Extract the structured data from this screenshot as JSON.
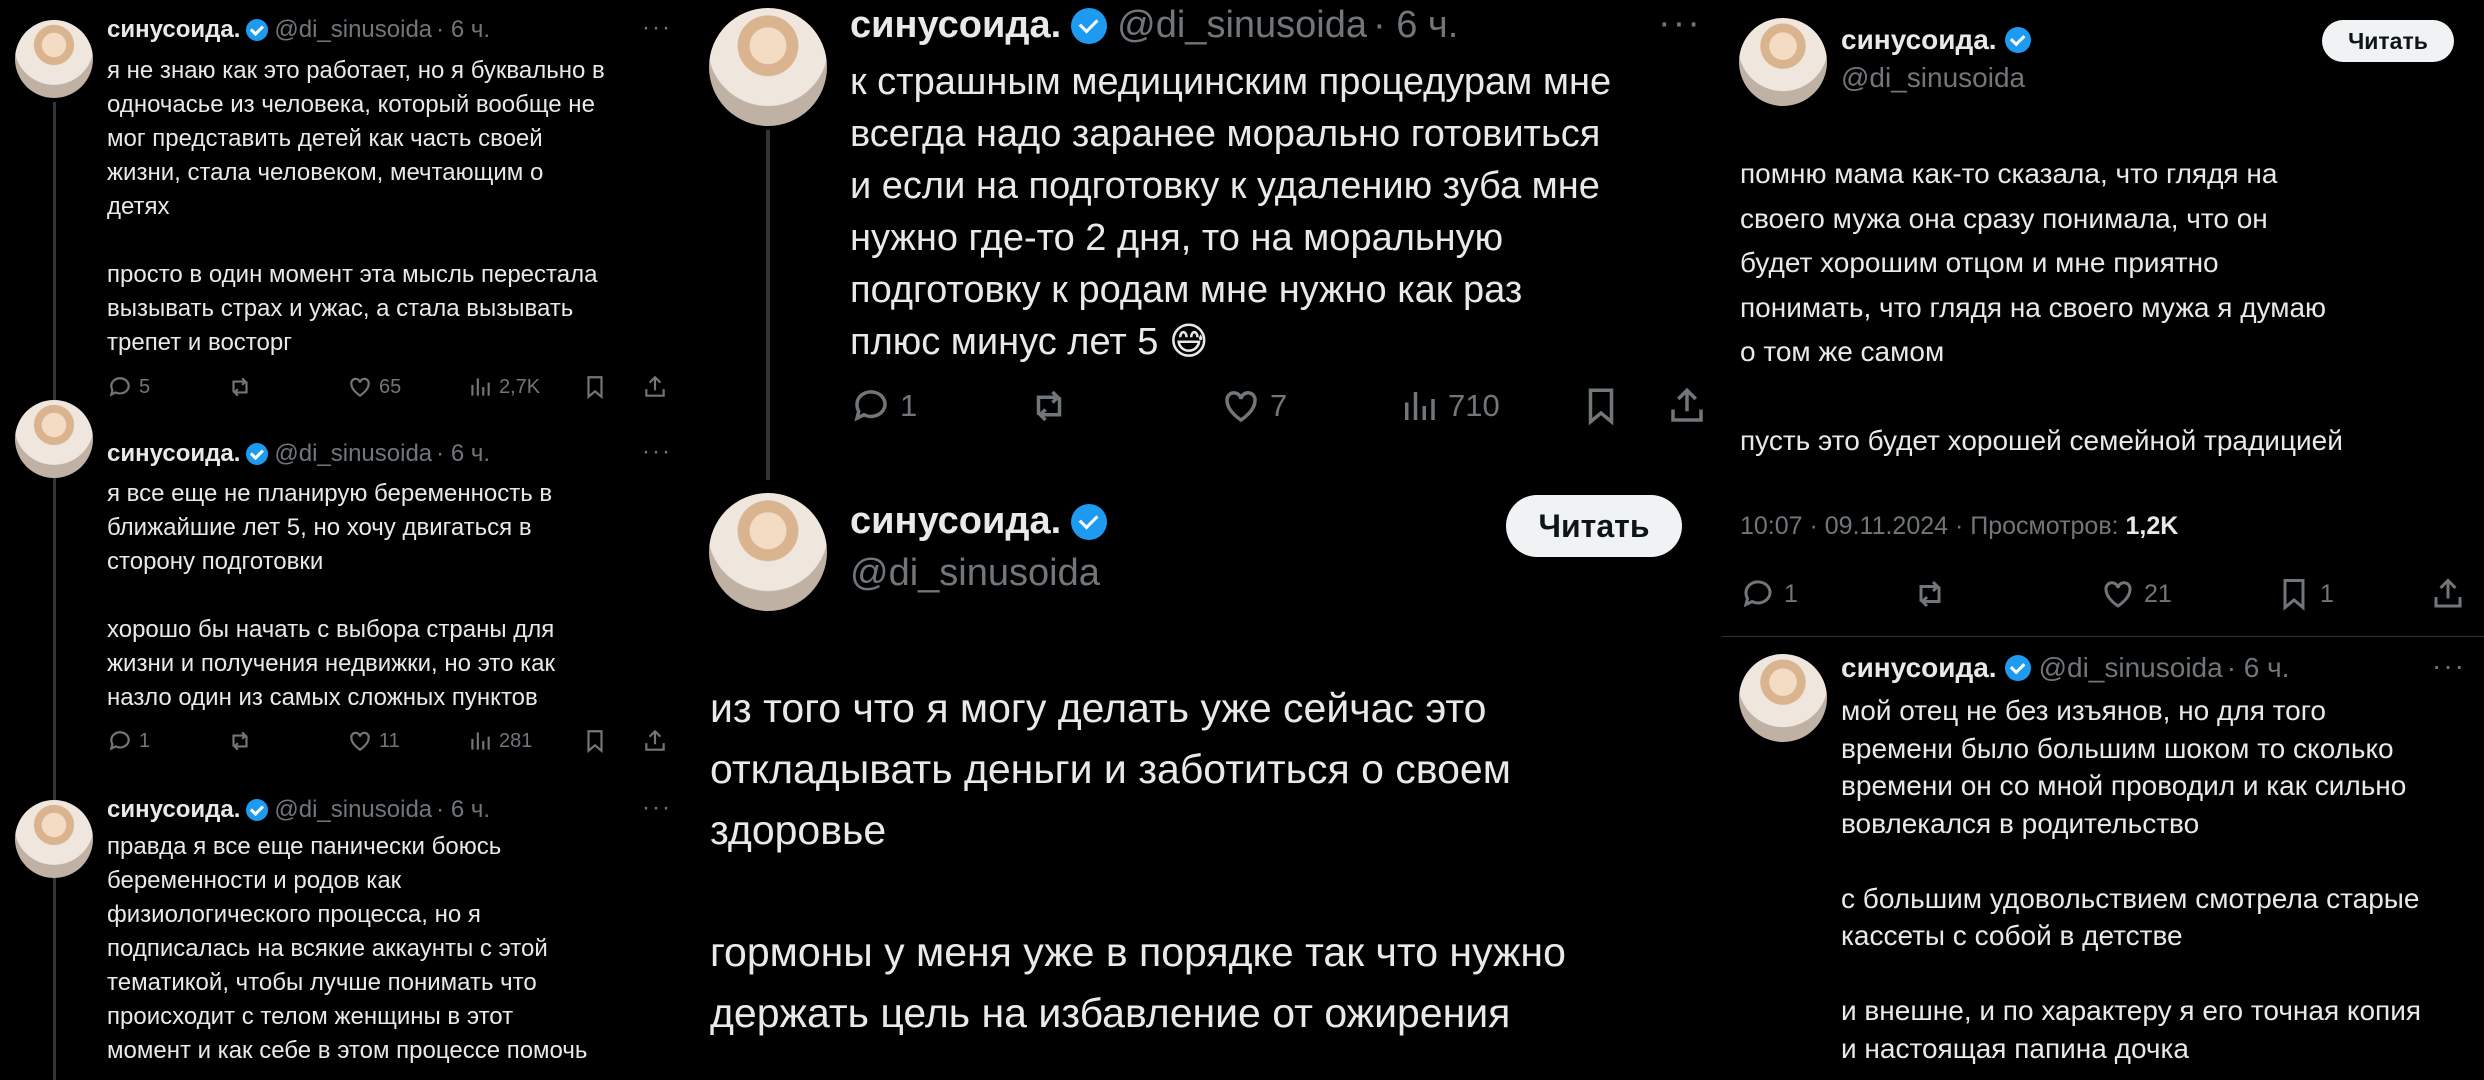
{
  "user": {
    "name": "синусоида.",
    "handle": "@di_sinusoida",
    "time": "· 6 ч.",
    "follow_label": "Читать"
  },
  "panel1": {
    "tweets": [
      {
        "text": "я не знаю как это работает, но я буквально в\nодночасье из человека, который вообще не\nмог представить детей как часть своей\nжизни, стала человеком, мечтающим о\nдетях\n\nпросто в один момент эта мысль перестала\nвызывать страх и ужас, а стала вызывать\nтрепет и восторг",
        "replies": "5",
        "likes": "65",
        "views": "2,7K"
      },
      {
        "text": "я все еще не планирую беременность в\nближайшие лет 5, но хочу двигаться в\nсторону подготовки\n\nхорошо бы начать с выбора страны для\nжизни и получения недвижки, но это как\nназло один из самых сложных пунктов",
        "replies": "1",
        "likes": "11",
        "views": "281"
      },
      {
        "text": "правда я все еще панически боюсь\nбеременности и родов как\nфизиологического процесса, но я\nподписалась на всякие аккаунты с этой\nтематикой, чтобы лучше понимать что\nпроисходит с телом женщины в этот\nмомент и как себе в этом процессе помочь"
      }
    ]
  },
  "panel2": {
    "tweet": {
      "text": "к страшным медицинским процедурам мне\nвсегда надо заранее морально готовиться\nи если на подготовку к удалению зуба мне\nнужно где-то 2 дня, то на моральную\nподготовку к родам мне нужно как раз\nплюс минус лет 5 😅",
      "replies": "1",
      "likes": "7",
      "views": "710"
    },
    "main_text": "из того что я могу делать уже сейчас это\nоткладывать деньги и заботиться о своем\nздоровье\n\nгормоны у меня уже в порядке так что нужно\nдержать цель на избавление от ожирения"
  },
  "panel3": {
    "main_text": "помню мама как-то сказала, что глядя на\nсвоего мужа она сразу понимала, что он\nбудет хорошим отцом и мне приятно\nпонимать, что глядя на своего мужа я думаю\nо том же самом\n\nпусть это будет хорошей семейной традицией",
    "meta_time": "10:07 · 09.11.2024 · Просмотров: ",
    "meta_views": "1,2K",
    "replies": "1",
    "likes": "21",
    "bookmarks": "1",
    "reply_text": "мой отец не без изъянов, но для того\nвремени было большим шоком то сколько\nвремени он со мной проводил и как сильно\nвовлекался в родительство\n\nс большим удовольствием смотрела старые\nкассеты с собой в детстве\n\nи внешне, и по характеру я его точная копия\nи настоящая папина дочка"
  },
  "icons": [
    "reply-icon",
    "retweet-icon",
    "like-icon",
    "views-icon",
    "bookmark-icon",
    "share-icon",
    "more-icon",
    "verified-icon"
  ]
}
